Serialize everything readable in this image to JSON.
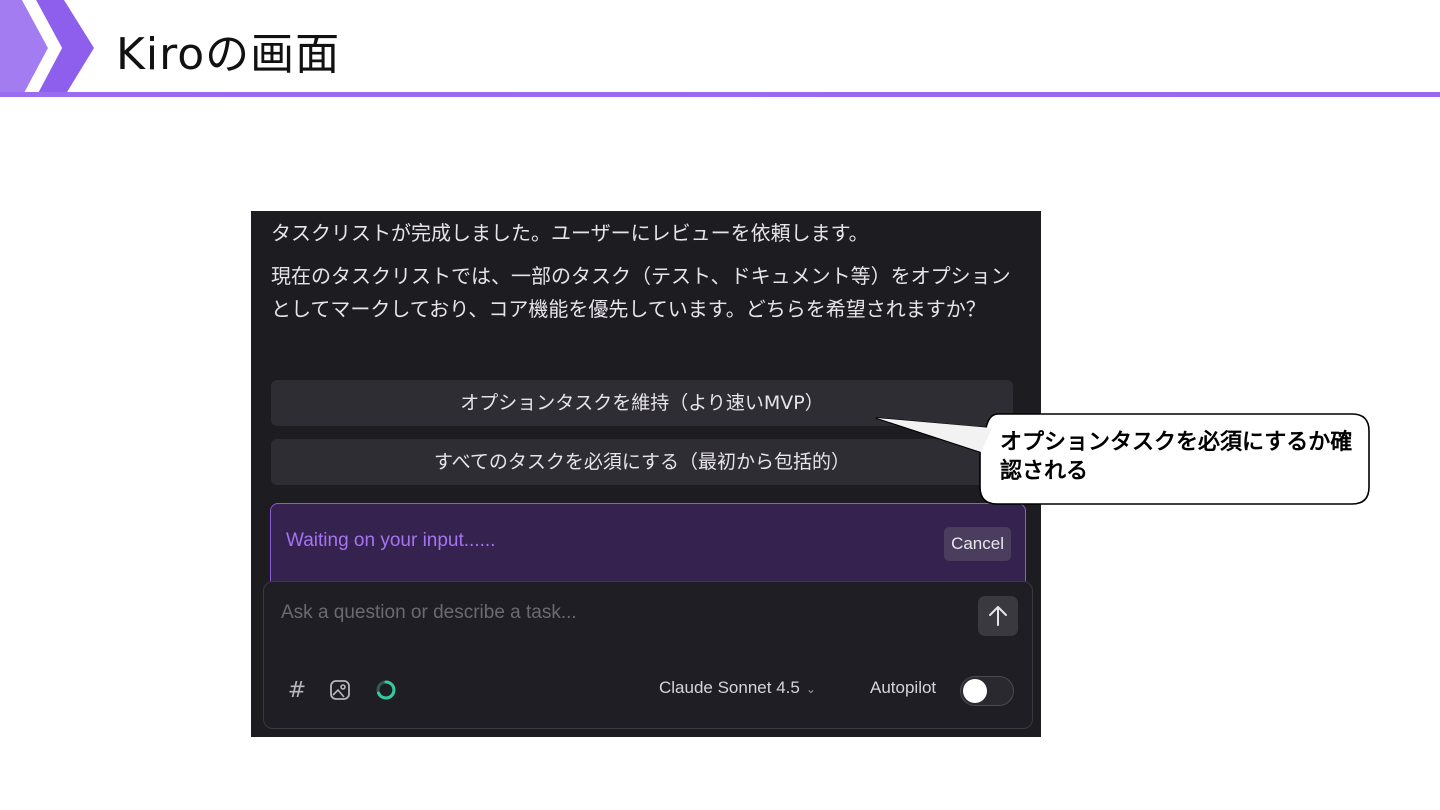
{
  "slide": {
    "title": "Kiroの画面",
    "accent_color": "#9b6bf0"
  },
  "chat": {
    "message_1": "タスクリストが完成しました。ユーザーにレビューを依頼します。",
    "message_2": "現在のタスクリストでは、一部のタスク（テスト、ドキュメント等）をオプションとしてマークしており、コア機能を優先しています。どちらを希望されますか？",
    "options": [
      {
        "label": "オプションタスクを維持（より速いMVP）"
      },
      {
        "label": "すべてのタスクを必須にする（最初から包括的）"
      }
    ],
    "waiting": {
      "text": "Waiting on your input......",
      "cancel_label": "Cancel"
    },
    "input": {
      "placeholder": "Ask a question or describe a task...",
      "value": ""
    },
    "toolbar": {
      "hash_label": "#",
      "model": "Claude Sonnet 4.5",
      "autopilot_label": "Autopilot",
      "autopilot_enabled": false,
      "icons": [
        "hash-icon",
        "image-icon",
        "spinner-icon",
        "arrow-up-icon",
        "chevron-down-icon"
      ]
    }
  },
  "callout": {
    "text": "オプションタスクを必須にするか確認される"
  }
}
